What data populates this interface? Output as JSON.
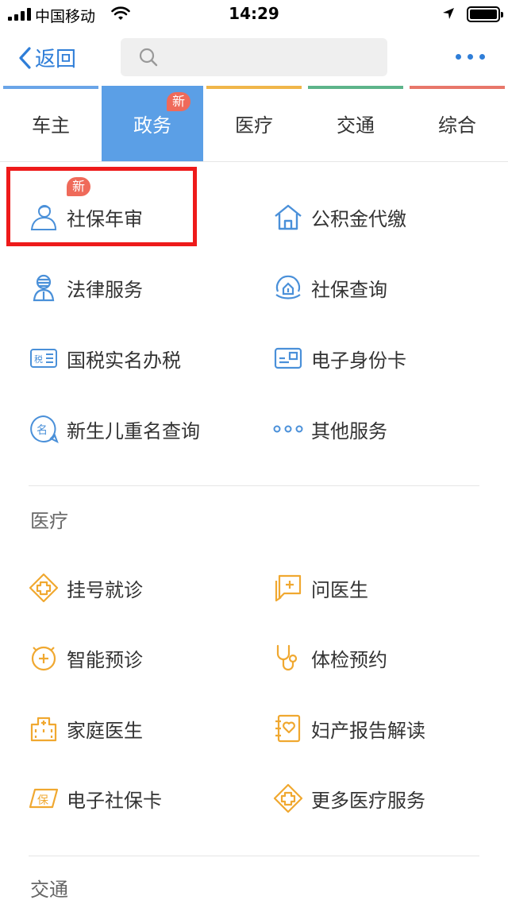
{
  "status_bar": {
    "carrier": "中国移动",
    "time": "14:29"
  },
  "nav": {
    "back_label": "返回",
    "search_placeholder": ""
  },
  "tabs": [
    {
      "label": "车主",
      "bar_color": "#6aa5e8"
    },
    {
      "label": "政务",
      "bar_color": "#5b9fe6",
      "badge": "新"
    },
    {
      "label": "医疗",
      "bar_color": "#f0b64a"
    },
    {
      "label": "交通",
      "bar_color": "#5db48a"
    },
    {
      "label": "综合",
      "bar_color": "#e8776a"
    }
  ],
  "gov_items": [
    {
      "label": "社保年审",
      "icon": "person-icon",
      "badge": "新"
    },
    {
      "label": "公积金代缴",
      "icon": "home-icon"
    },
    {
      "label": "法律服务",
      "icon": "lawyer-icon"
    },
    {
      "label": "社保查询",
      "icon": "social-security-icon"
    },
    {
      "label": "国税实名办税",
      "icon": "tax-icon"
    },
    {
      "label": "电子身份卡",
      "icon": "id-card-icon"
    },
    {
      "label": "新生儿重名查询",
      "icon": "name-icon"
    },
    {
      "label": "其他服务",
      "icon": "more-dots-icon"
    }
  ],
  "medical": {
    "title": "医疗",
    "items": [
      {
        "label": "挂号就诊",
        "icon": "medical-cross-icon"
      },
      {
        "label": "问医生",
        "icon": "chat-doctor-icon"
      },
      {
        "label": "智能预诊",
        "icon": "smart-diagnosis-icon"
      },
      {
        "label": "体检预约",
        "icon": "stethoscope-icon"
      },
      {
        "label": "家庭医生",
        "icon": "family-doctor-icon"
      },
      {
        "label": "妇产报告解读",
        "icon": "report-icon"
      },
      {
        "label": "电子社保卡",
        "icon": "insurance-card-icon"
      },
      {
        "label": "更多医疗服务",
        "icon": "more-medical-icon"
      }
    ]
  },
  "traffic": {
    "title": "交通"
  },
  "colors": {
    "accent_blue": "#2f7ed8",
    "icon_blue": "#4a90d9",
    "icon_orange": "#f0a830",
    "highlight_red": "#ee1a1a",
    "badge_red": "#ef6a5a"
  }
}
